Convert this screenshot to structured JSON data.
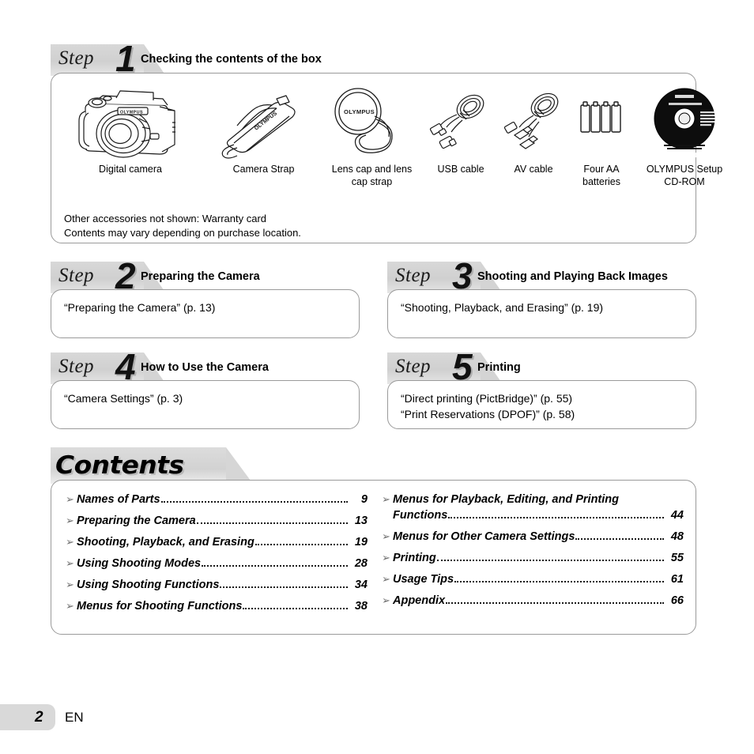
{
  "page": {
    "number": "2",
    "language": "EN"
  },
  "steps": [
    {
      "word": "Step",
      "number": "1",
      "title": "Checking the contents of the box"
    },
    {
      "word": "Step",
      "number": "2",
      "title": "Preparing the Camera",
      "body": "“Preparing the Camera” (p. 13)"
    },
    {
      "word": "Step",
      "number": "3",
      "title": "Shooting and Playing Back Images",
      "body": "“Shooting, Playback, and Erasing” (p. 19)"
    },
    {
      "word": "Step",
      "number": "4",
      "title": "How to Use the Camera",
      "body": "“Camera Settings” (p. 3)"
    },
    {
      "word": "Step",
      "number": "5",
      "title": "Printing",
      "body": "“Direct printing (PictBridge)” (p. 55)\n“Print Reservations (DPOF)” (p. 58)"
    }
  ],
  "box_contents": {
    "items": [
      {
        "icon": "digital-camera-icon",
        "caption": "Digital camera"
      },
      {
        "icon": "camera-strap-icon",
        "caption": "Camera Strap"
      },
      {
        "icon": "lens-cap-icon",
        "caption": "Lens cap and lens\ncap strap"
      },
      {
        "icon": "usb-cable-icon",
        "caption": "USB cable"
      },
      {
        "icon": "av-cable-icon",
        "caption": "AV cable"
      },
      {
        "icon": "aa-batteries-icon",
        "caption": "Four AA\nbatteries"
      },
      {
        "icon": "cd-rom-icon",
        "caption": "OLYMPUS Setup\nCD-ROM"
      }
    ],
    "note": "Other accessories not shown: Warranty card\nContents may vary depending on purchase location."
  },
  "contents": {
    "heading": "Contents",
    "left_column": [
      {
        "label": "Names of Parts",
        "page": "9"
      },
      {
        "label": "Preparing the Camera",
        "page": "13"
      },
      {
        "label": "Shooting, Playback, and Erasing",
        "page": "19"
      },
      {
        "label": "Using Shooting Modes",
        "page": "28"
      },
      {
        "label": "Using Shooting Functions",
        "page": "34"
      },
      {
        "label": "Menus for Shooting Functions",
        "page": "38"
      }
    ],
    "right_column": [
      {
        "label_line1": "Menus for Playback, Editing, and Printing",
        "label_line2": "Functions",
        "page": "44"
      },
      {
        "label": "Menus for Other Camera Settings",
        "page": "48"
      },
      {
        "label": "Printing",
        "page": "55"
      },
      {
        "label": "Usage Tips",
        "page": "61"
      },
      {
        "label": "Appendix",
        "page": "66"
      }
    ],
    "bullet_glyph": "➢"
  },
  "brand": {
    "name": "OLYMPUS"
  },
  "colors": {
    "band_gray": "#d4d4d4",
    "panel_border": "#9a9a9a",
    "text": "#000000",
    "footer_chip": "#d9d9d9"
  }
}
